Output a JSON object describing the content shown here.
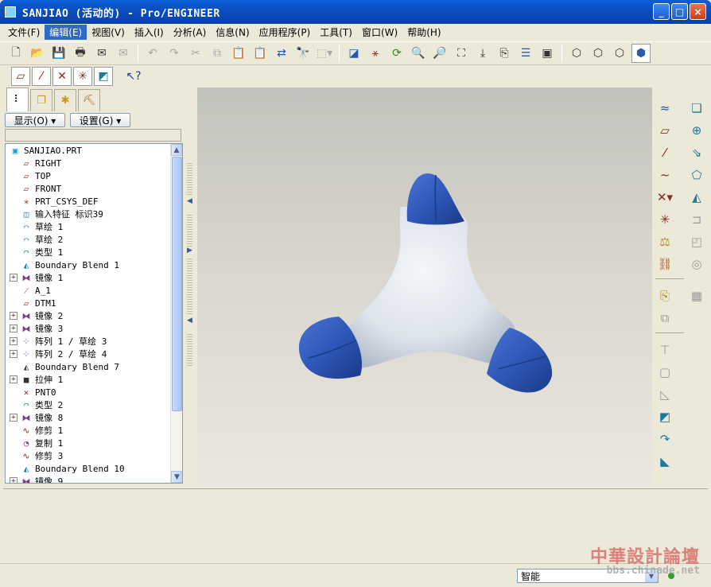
{
  "window": {
    "title": "SANJIAO (活动的) - Pro/ENGINEER",
    "minimize_label": "_",
    "maximize_label": "□",
    "close_label": "×"
  },
  "menu": [
    {
      "label": "文件(F)"
    },
    {
      "label": "编辑(E)"
    },
    {
      "label": "视图(V)"
    },
    {
      "label": "插入(I)"
    },
    {
      "label": "分析(A)"
    },
    {
      "label": "信息(N)"
    },
    {
      "label": "应用程序(P)"
    },
    {
      "label": "工具(T)"
    },
    {
      "label": "窗口(W)"
    },
    {
      "label": "帮助(H)"
    }
  ],
  "model_panel": {
    "show_button": "显示(O) ▾",
    "settings_button": "设置(G) ▾"
  },
  "model_tree": [
    {
      "label": "SANJIAO.PRT"
    },
    {
      "label": "RIGHT"
    },
    {
      "label": "TOP"
    },
    {
      "label": "FRONT"
    },
    {
      "label": "PRT_CSYS_DEF"
    },
    {
      "label": "输入特征 标识39"
    },
    {
      "label": "草绘 1"
    },
    {
      "label": "草绘 2"
    },
    {
      "label": "类型 1"
    },
    {
      "label": "Boundary Blend 1"
    },
    {
      "label": "镜像 1"
    },
    {
      "label": "A_1"
    },
    {
      "label": "DTM1"
    },
    {
      "label": "镜像 2"
    },
    {
      "label": "镜像 3"
    },
    {
      "label": "阵列 1 / 草绘 3"
    },
    {
      "label": "阵列 2 / 草绘 4"
    },
    {
      "label": "Boundary Blend 7"
    },
    {
      "label": "拉伸 1"
    },
    {
      "label": "PNT0"
    },
    {
      "label": "类型 2"
    },
    {
      "label": "镜像 8"
    },
    {
      "label": "修剪 1"
    },
    {
      "label": "复制 1"
    },
    {
      "label": "修剪 3"
    },
    {
      "label": "Boundary Blend 10"
    },
    {
      "label": "镜像 9"
    }
  ],
  "statusbar": {
    "filter_value": "智能"
  },
  "watermark": {
    "title": "中華設計論壇",
    "url": "bbs.chinade.net"
  },
  "colors": {
    "titlebar": "#0a4fc0",
    "model_cap": "#2e57b8",
    "model_body": "#e4e9ef",
    "selection": "#316ac5"
  }
}
